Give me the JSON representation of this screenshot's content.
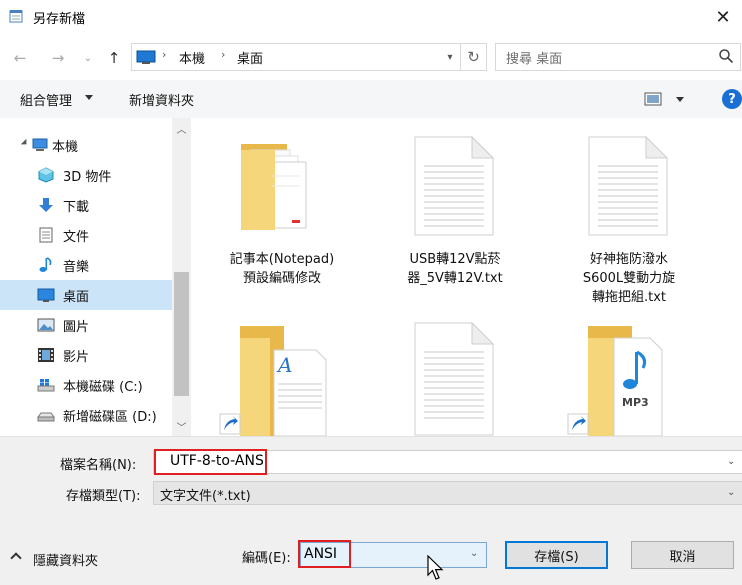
{
  "window": {
    "title": "另存新檔",
    "icon": "notepad-icon"
  },
  "address": {
    "segments": [
      "本機",
      "桌面"
    ],
    "search_placeholder": "搜尋 桌面"
  },
  "toolbar": {
    "organize_label": "組合管理",
    "new_folder_label": "新增資料夾",
    "help_label": "?"
  },
  "nav": {
    "items": [
      {
        "label": "本機",
        "icon": "computer-icon"
      },
      {
        "label": "3D 物件",
        "icon": "cube-3d-icon"
      },
      {
        "label": "下載",
        "icon": "download-arrow-icon"
      },
      {
        "label": "文件",
        "icon": "document-icon"
      },
      {
        "label": "音樂",
        "icon": "music-note-icon"
      },
      {
        "label": "桌面",
        "icon": "desktop-icon"
      },
      {
        "label": "圖片",
        "icon": "pictures-icon"
      },
      {
        "label": "影片",
        "icon": "film-icon"
      },
      {
        "label": "本機磁碟 (C:)",
        "icon": "windows-drive-icon"
      },
      {
        "label": "新增磁碟區 (D:)",
        "icon": "drive-icon"
      }
    ],
    "selected": "桌面"
  },
  "files": [
    {
      "label_lines": [
        "記事本(Notepad)",
        "預設編碼修改"
      ],
      "icon": "folder-icon"
    },
    {
      "label_lines": [
        "USB轉12V點菸",
        "器_5V轉12V.txt"
      ],
      "icon": "text-file-icon"
    },
    {
      "label_lines": [
        "好神拖防潑水",
        "S600L雙動力旋",
        "轉拖把組.txt"
      ],
      "icon": "text-file-icon"
    },
    {
      "label_lines": [],
      "icon": "folder-shortcut-wordpad-icon"
    },
    {
      "label_lines": [],
      "icon": "text-file-icon"
    },
    {
      "label_lines": [],
      "icon": "folder-shortcut-mp3-icon"
    }
  ],
  "form": {
    "filename_label": "檔案名稱(N):",
    "filename_value": "UTF-8-to-ANSI",
    "filetype_label": "存檔類型(T):",
    "filetype_value": "文字文件(*.txt)",
    "encoding_label": "編碼(E):",
    "encoding_value": "ANSI",
    "mp3_badge": "MP3"
  },
  "buttons": {
    "hide_folders": "隱藏資料夾",
    "save": "存檔(S)",
    "cancel": "取消"
  },
  "colors": {
    "highlight_box": "#e02020",
    "selection": "#cce4f7",
    "accent": "#0078d7",
    "folder": "#f6d67a"
  }
}
